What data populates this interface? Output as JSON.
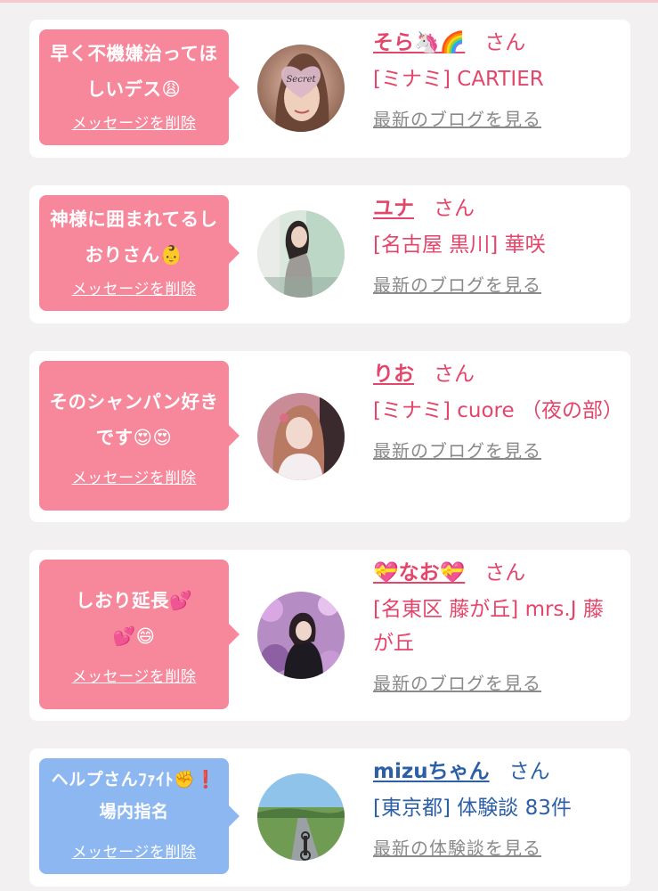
{
  "cards": [
    {
      "message": "早く不機嫌治ってほしいデス😩",
      "delete_label": "メッセージを削除",
      "name": "そら🦄🌈",
      "honorific": "さん",
      "shop": "[ミナミ] CARTIER",
      "link": "最新のブログを見る",
      "avatar_text": "Secret"
    },
    {
      "message": "神様に囲まれてるしおりさん👶",
      "delete_label": "メッセージを削除",
      "name": "ユナ",
      "honorific": "さん",
      "shop": "[名古屋 黒川] 華咲",
      "link": "最新のブログを見る"
    },
    {
      "message": "そのシャンパン好きです😍😍",
      "delete_label": "メッセージを削除",
      "name": "りお",
      "honorific": "さん",
      "shop": "[ミナミ] cuore （夜の部）",
      "link": "最新のブログを見る"
    },
    {
      "message": "しおり延長💕💕😄",
      "delete_label": "メッセージを削除",
      "name": "💝なお💝",
      "honorific": "さん",
      "shop": "[名東区 藤が丘] mrs.J 藤が丘",
      "link": "最新のブログを見る"
    },
    {
      "message": "ヘルプさんﾌｧｲﾄ✊❗場内指名",
      "delete_label": "メッセージを削除",
      "name": "mizuちゃん",
      "honorific": "さん",
      "shop": "[東京都] 体験談 83件",
      "link": "最新の体験談を見る"
    }
  ],
  "colors": {
    "pink_bubble": "#f7879b",
    "blue_bubble": "#8cb7f1",
    "pink_text": "#e4456a",
    "blue_text": "#2c5fa6",
    "link_gray": "#8a8a8a"
  }
}
